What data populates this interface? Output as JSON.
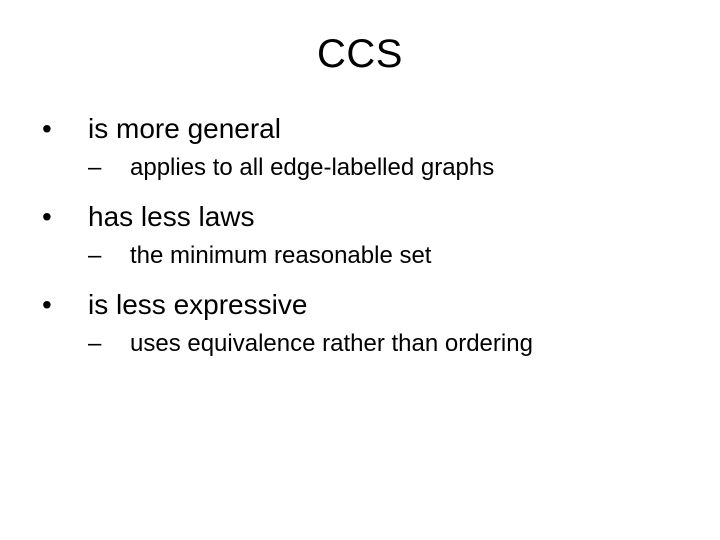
{
  "title": "CCS",
  "items": [
    {
      "text": "is more general",
      "sub": [
        {
          "text": "applies to all edge-labelled graphs"
        }
      ]
    },
    {
      "text": "has less laws",
      "sub": [
        {
          "text": "the minimum reasonable set"
        }
      ]
    },
    {
      "text": "is less expressive",
      "sub": [
        {
          "text": "uses equivalence rather than ordering"
        }
      ]
    }
  ]
}
